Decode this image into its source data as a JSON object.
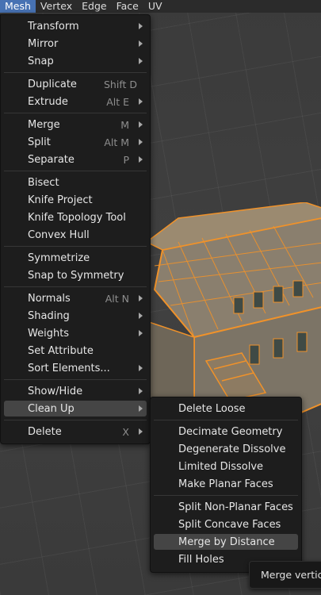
{
  "header": {
    "menus": [
      "Mesh",
      "Vertex",
      "Edge",
      "Face",
      "UV"
    ]
  },
  "mesh_menu": {
    "items": [
      {
        "label": "Transform",
        "shortcut": "",
        "submenu": true
      },
      {
        "label": "Mirror",
        "shortcut": "",
        "submenu": true
      },
      {
        "label": "Snap",
        "shortcut": "",
        "submenu": true
      },
      {
        "label": "Duplicate",
        "shortcut": "Shift D",
        "submenu": false
      },
      {
        "label": "Extrude",
        "shortcut": "Alt E",
        "submenu": true
      },
      {
        "label": "Merge",
        "shortcut": "M",
        "submenu": true
      },
      {
        "label": "Split",
        "shortcut": "Alt M",
        "submenu": true
      },
      {
        "label": "Separate",
        "shortcut": "P",
        "submenu": true
      },
      {
        "label": "Bisect",
        "shortcut": "",
        "submenu": false
      },
      {
        "label": "Knife Project",
        "shortcut": "",
        "submenu": false
      },
      {
        "label": "Knife Topology Tool",
        "shortcut": "",
        "submenu": false
      },
      {
        "label": "Convex Hull",
        "shortcut": "",
        "submenu": false
      },
      {
        "label": "Symmetrize",
        "shortcut": "",
        "submenu": false
      },
      {
        "label": "Snap to Symmetry",
        "shortcut": "",
        "submenu": false
      },
      {
        "label": "Normals",
        "shortcut": "Alt N",
        "submenu": true
      },
      {
        "label": "Shading",
        "shortcut": "",
        "submenu": true
      },
      {
        "label": "Weights",
        "shortcut": "",
        "submenu": true
      },
      {
        "label": "Set Attribute",
        "shortcut": "",
        "submenu": false
      },
      {
        "label": "Sort Elements...",
        "shortcut": "",
        "submenu": true
      },
      {
        "label": "Show/Hide",
        "shortcut": "",
        "submenu": true
      },
      {
        "label": "Clean Up",
        "shortcut": "",
        "submenu": true
      },
      {
        "label": "Delete",
        "shortcut": "X",
        "submenu": true
      }
    ]
  },
  "cleanup_menu": {
    "items": [
      {
        "label": "Delete Loose"
      },
      {
        "label": "Decimate Geometry"
      },
      {
        "label": "Degenerate Dissolve"
      },
      {
        "label": "Limited Dissolve"
      },
      {
        "label": "Make Planar Faces"
      },
      {
        "label": "Split Non-Planar Faces"
      },
      {
        "label": "Split Concave Faces"
      },
      {
        "label": "Merge by Distance"
      },
      {
        "label": "Fill Holes"
      }
    ]
  },
  "tooltip": {
    "text": "Merge vertices"
  },
  "colors": {
    "accent": "#4772b3",
    "selection": "#f0922a",
    "menu_bg": "#1d1d1d"
  }
}
